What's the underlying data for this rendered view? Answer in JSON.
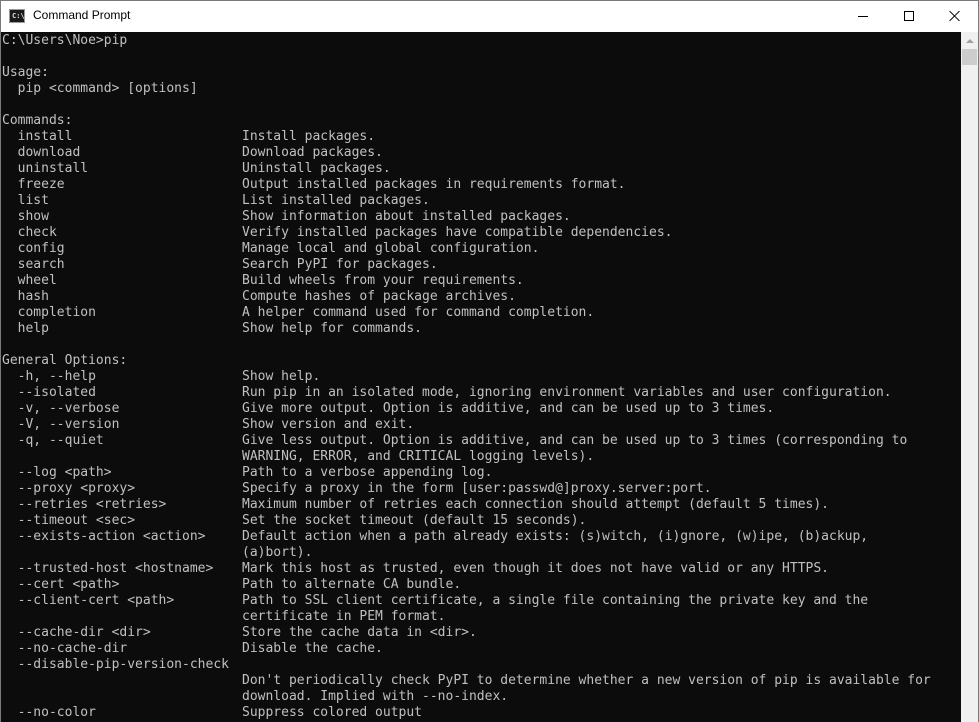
{
  "window": {
    "title": "Command Prompt",
    "icon_label": "C:\\"
  },
  "controls": {
    "minimize_icon": "minimize-icon",
    "maximize_icon": "maximize-icon",
    "close_icon": "close-icon"
  },
  "console": {
    "prompt": "C:\\Users\\Noe>pip",
    "usage_header": "Usage:",
    "usage_line": "  pip <command> [options]",
    "commands_header": "Commands:",
    "commands": [
      {
        "cmd": "  install",
        "desc": "Install packages."
      },
      {
        "cmd": "  download",
        "desc": "Download packages."
      },
      {
        "cmd": "  uninstall",
        "desc": "Uninstall packages."
      },
      {
        "cmd": "  freeze",
        "desc": "Output installed packages in requirements format."
      },
      {
        "cmd": "  list",
        "desc": "List installed packages."
      },
      {
        "cmd": "  show",
        "desc": "Show information about installed packages."
      },
      {
        "cmd": "  check",
        "desc": "Verify installed packages have compatible dependencies."
      },
      {
        "cmd": "  config",
        "desc": "Manage local and global configuration."
      },
      {
        "cmd": "  search",
        "desc": "Search PyPI for packages."
      },
      {
        "cmd": "  wheel",
        "desc": "Build wheels from your requirements."
      },
      {
        "cmd": "  hash",
        "desc": "Compute hashes of package archives."
      },
      {
        "cmd": "  completion",
        "desc": "A helper command used for command completion."
      },
      {
        "cmd": "  help",
        "desc": "Show help for commands."
      }
    ],
    "general_header": "General Options:",
    "options": [
      {
        "opt": "  -h, --help",
        "desc": "Show help."
      },
      {
        "opt": "  --isolated",
        "desc": "Run pip in an isolated mode, ignoring environment variables and user configuration."
      },
      {
        "opt": "  -v, --verbose",
        "desc": "Give more output. Option is additive, and can be used up to 3 times."
      },
      {
        "opt": "  -V, --version",
        "desc": "Show version and exit."
      },
      {
        "opt": "  -q, --quiet",
        "desc": "Give less output. Option is additive, and can be used up to 3 times (corresponding to"
      },
      {
        "opt": "",
        "desc": "WARNING, ERROR, and CRITICAL logging levels)."
      },
      {
        "opt": "  --log <path>",
        "desc": "Path to a verbose appending log."
      },
      {
        "opt": "  --proxy <proxy>",
        "desc": "Specify a proxy in the form [user:passwd@]proxy.server:port."
      },
      {
        "opt": "  --retries <retries>",
        "desc": "Maximum number of retries each connection should attempt (default 5 times)."
      },
      {
        "opt": "  --timeout <sec>",
        "desc": "Set the socket timeout (default 15 seconds)."
      },
      {
        "opt": "  --exists-action <action>",
        "desc": "Default action when a path already exists: (s)witch, (i)gnore, (w)ipe, (b)ackup,"
      },
      {
        "opt": "",
        "desc": "(a)bort)."
      },
      {
        "opt": "  --trusted-host <hostname>",
        "desc": "Mark this host as trusted, even though it does not have valid or any HTTPS."
      },
      {
        "opt": "  --cert <path>",
        "desc": "Path to alternate CA bundle."
      },
      {
        "opt": "  --client-cert <path>",
        "desc": "Path to SSL client certificate, a single file containing the private key and the"
      },
      {
        "opt": "",
        "desc": "certificate in PEM format."
      },
      {
        "opt": "  --cache-dir <dir>",
        "desc": "Store the cache data in <dir>."
      },
      {
        "opt": "  --no-cache-dir",
        "desc": "Disable the cache."
      },
      {
        "opt": "  --disable-pip-version-check",
        "desc": ""
      },
      {
        "opt": "",
        "desc": "Don't periodically check PyPI to determine whether a new version of pip is available for"
      },
      {
        "opt": "",
        "desc": "download. Implied with --no-index."
      },
      {
        "opt": "  --no-color",
        "desc": "Suppress colored output"
      }
    ]
  },
  "colors": {
    "console_bg": "#0c0c0c",
    "console_text": "#c0c0c0"
  }
}
